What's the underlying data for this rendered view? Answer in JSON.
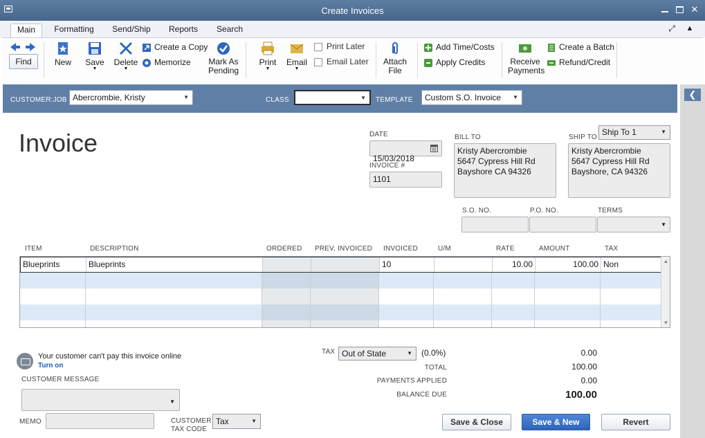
{
  "window": {
    "title": "Create Invoices"
  },
  "tabs": [
    "Main",
    "Formatting",
    "Send/Ship",
    "Reports",
    "Search"
  ],
  "ribbon": {
    "find": "Find",
    "new": "New",
    "save": "Save",
    "delete": "Delete",
    "create_copy": "Create a Copy",
    "memorize": "Memorize",
    "mark_pending": "Mark As Pending",
    "print": "Print",
    "email": "Email",
    "print_later": "Print Later",
    "email_later": "Email Later",
    "attach_file": "Attach File",
    "add_time_costs": "Add Time/Costs",
    "apply_credits": "Apply Credits",
    "receive_payments": "Receive Payments",
    "create_batch": "Create a Batch",
    "refund_credit": "Refund/Credit"
  },
  "customer_bar": {
    "customer_label": "CUSTOMER:JOB",
    "customer_value": "Abercrombie, Kristy",
    "class_label": "CLASS",
    "class_value": "",
    "template_label": "TEMPLATE",
    "template_value": "Custom S.O. Invoice"
  },
  "form": {
    "title": "Invoice",
    "date_label": "DATE",
    "date": "15/03/2018",
    "invoice_no_label": "INVOICE #",
    "invoice_no": "1101",
    "bill_to_label": "BILL TO",
    "bill_to": "Kristy Abercrombie\n5647 Cypress Hill Rd\nBayshore CA 94326",
    "ship_to_label": "SHIP TO",
    "ship_to_select": "Ship To 1",
    "ship_to": "Kristy Abercrombie\n5647 Cypress Hill Rd\nBayshore, CA 94326",
    "so_no_label": "S.O. NO.",
    "po_no_label": "P.O. NO.",
    "terms_label": "TERMS",
    "so_no": "",
    "po_no": "",
    "terms": ""
  },
  "grid": {
    "headers": [
      "ITEM",
      "DESCRIPTION",
      "ORDERED",
      "PREV. INVOICED",
      "INVOICED",
      "U/M",
      "RATE",
      "AMOUNT",
      "TAX"
    ],
    "rows": [
      {
        "item": "Blueprints",
        "description": "Blueprints",
        "ordered": "",
        "prev_invoiced": "",
        "invoiced": "10",
        "um": "",
        "rate": "10.00",
        "amount": "100.00",
        "tax": "Non"
      }
    ]
  },
  "bottom": {
    "online_msg": "Your customer can't pay this invoice online",
    "turn_on": "Turn on",
    "customer_message_label": "CUSTOMER MESSAGE",
    "memo_label": "MEMO",
    "customer_tax_code_label": "CUSTOMER TAX CODE",
    "customer_tax_code": "Tax",
    "tax_label": "TAX",
    "tax_select": "Out of State",
    "tax_rate": "(0.0%)",
    "tax_amount": "0.00",
    "total_label": "TOTAL",
    "total": "100.00",
    "payments_applied_label": "PAYMENTS APPLIED",
    "payments_applied": "0.00",
    "balance_due_label": "BALANCE DUE",
    "balance_due": "100.00"
  },
  "buttons": {
    "save_close": "Save & Close",
    "save_new": "Save & New",
    "revert": "Revert"
  },
  "colors": {
    "title_bar": "#4f6f96",
    "customer_bar": "#5f7fa6",
    "primary_button": "#2f64b8",
    "link": "#1e5bb8"
  }
}
